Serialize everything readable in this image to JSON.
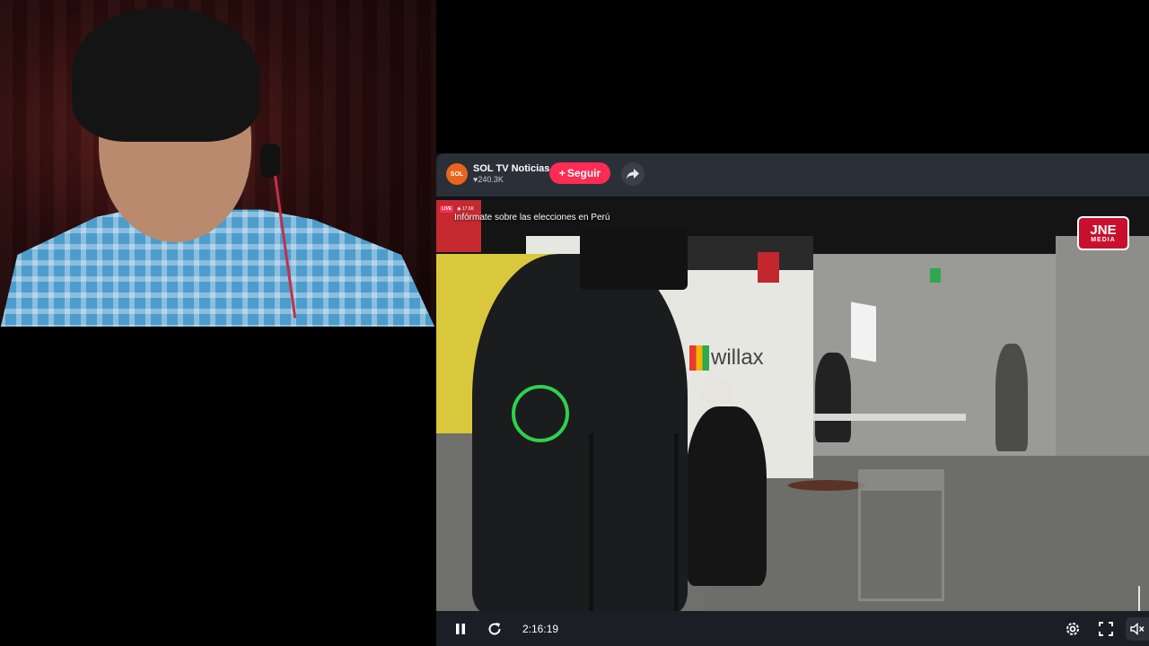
{
  "stream": {
    "channel_name": "SOL TV Noticias",
    "channel_avatar_text": "SOL",
    "likes": "240.3K",
    "follow_label": "Seguir",
    "title": "Infórmate sobre las elecciones en Perú",
    "live_badge": "LIVE",
    "viewers": "17.6K"
  },
  "overlay": {
    "logo_big": "JNE",
    "logo_small": "MEDIA"
  },
  "scene": {
    "booth_brand": "willax"
  },
  "controls": {
    "time": "2:16:19",
    "volume_level": 0.05
  },
  "colors": {
    "follow": "#fe2c55",
    "header_bg": "#2b2f38",
    "controls_bg": "#1b1e25",
    "jne_red": "#c8102e"
  },
  "icons": [
    "pause-icon",
    "replay-icon",
    "settings-icon",
    "fullscreen-icon",
    "mute-icon",
    "share-icon",
    "heart-icon",
    "plus-icon"
  ]
}
